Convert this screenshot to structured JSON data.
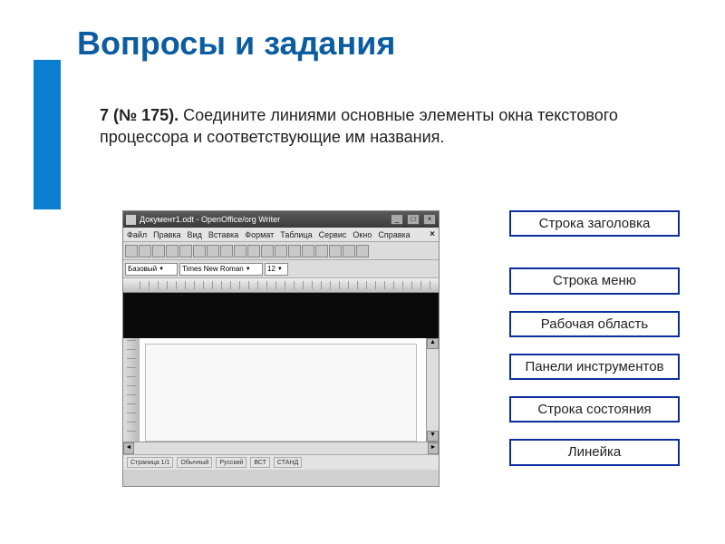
{
  "title": "Вопросы и задания",
  "task": {
    "number": "7 (№ 175).",
    "text": "Соедините линиями основные элементы окна текстового процессора и соответствующие им названия."
  },
  "editor": {
    "titlebar": "Документ1.odt - OpenOffice/org Writer",
    "menu": [
      "Файл",
      "Правка",
      "Вид",
      "Вставка",
      "Формат",
      "Таблица",
      "Сервис",
      "Окно",
      "Справка"
    ],
    "style_dd": "Базовый",
    "font_dd": "Times New Roman",
    "size_dd": "12",
    "status": {
      "page": "Страница 1/1",
      "style": "Обычный",
      "lang": "Русский",
      "ins": "ВСТ",
      "std": "СТАНД"
    }
  },
  "labels": [
    "Строка заголовка",
    "Строка меню",
    "Рабочая область",
    "Панели инструментов",
    "Строка состояния",
    "Линейка"
  ]
}
